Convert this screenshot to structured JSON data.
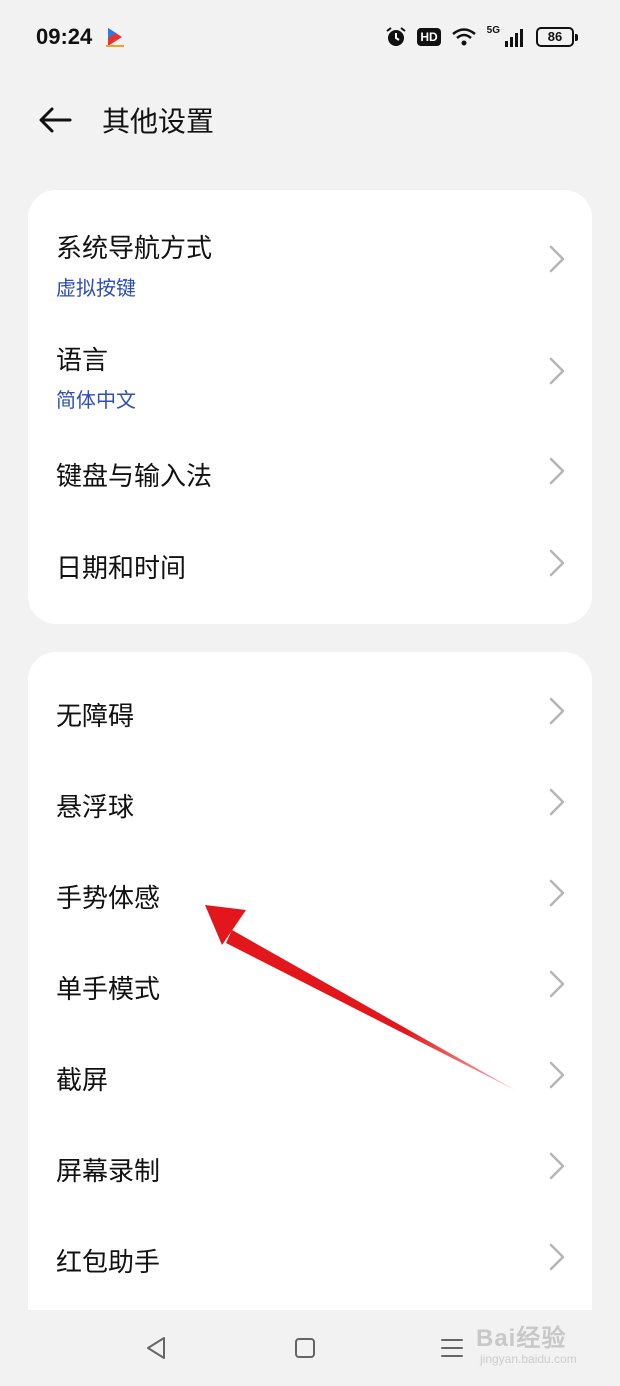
{
  "status_bar": {
    "time": "09:24",
    "hd_label": "HD",
    "network_label": "5G",
    "battery_level": "86",
    "icons": [
      "alarm-icon",
      "hd-icon",
      "wifi-icon",
      "signal-icon",
      "battery-icon"
    ]
  },
  "header": {
    "title": "其他设置",
    "back_icon": "arrow-left-icon"
  },
  "group1": [
    {
      "title": "系统导航方式",
      "subtitle": "虚拟按键"
    },
    {
      "title": "语言",
      "subtitle": "简体中文"
    },
    {
      "title": "键盘与输入法",
      "subtitle": ""
    },
    {
      "title": "日期和时间",
      "subtitle": ""
    }
  ],
  "group2": [
    {
      "title": "无障碍"
    },
    {
      "title": "悬浮球"
    },
    {
      "title": "手势体感"
    },
    {
      "title": "单手模式"
    },
    {
      "title": "截屏"
    },
    {
      "title": "屏幕录制"
    },
    {
      "title": "红包助手"
    }
  ],
  "nav_bar": {
    "icons": [
      "back-triangle-icon",
      "home-square-icon",
      "menu-lines-icon"
    ]
  },
  "watermark": {
    "brand": "Bai经验",
    "url": "jingyan.baidu.com"
  },
  "colors": {
    "background": "#f2f2f2",
    "card": "#ffffff",
    "subtitle": "#2e4fb3",
    "chevron": "#b5b5b5",
    "annotation_arrow": "#e3161b"
  }
}
